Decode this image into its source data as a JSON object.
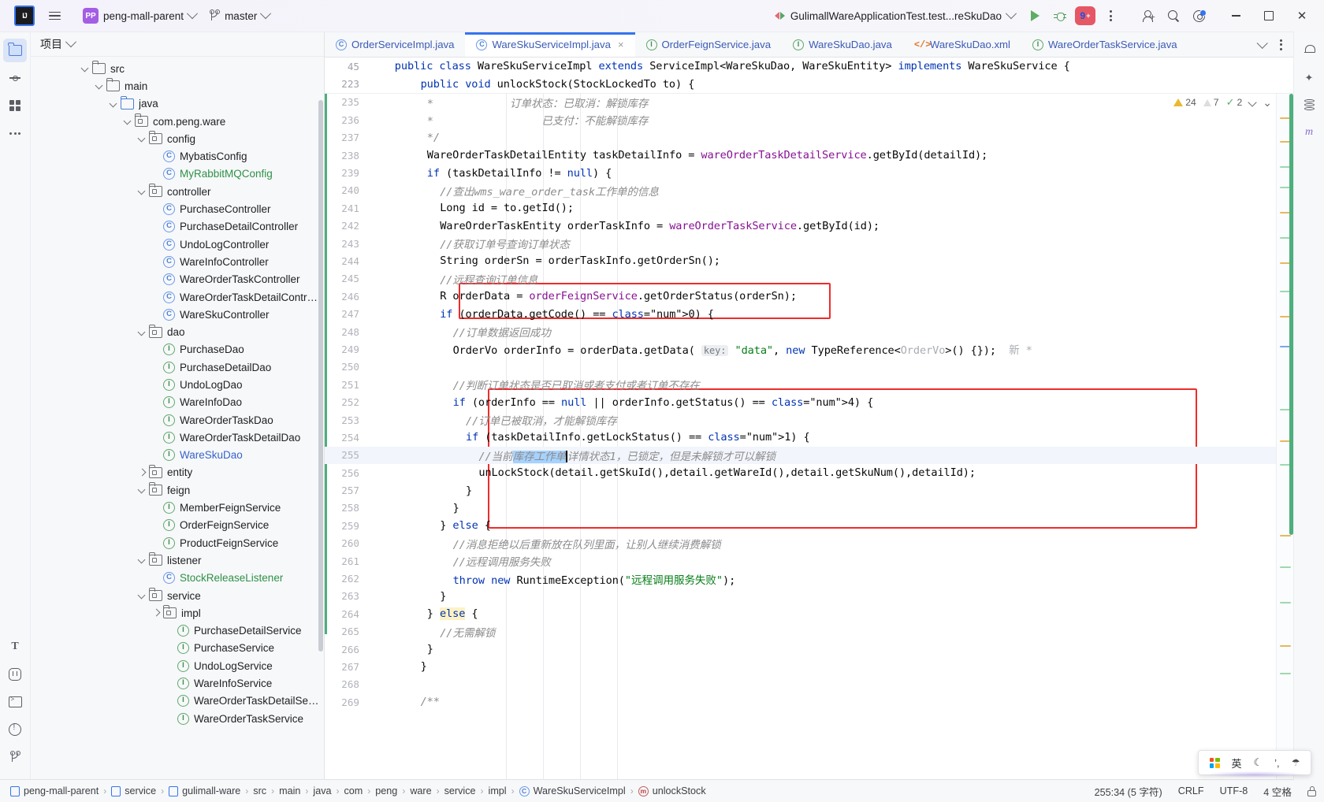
{
  "titlebar": {
    "logo": "IJ",
    "menu_icon": "hamburger-menu-icon",
    "project_badge": "PP",
    "project_name": "peng-mall-parent",
    "branch_name": "master",
    "run_config": "GulimallWareApplicationTest.test...reSkuDao",
    "run_label": "run-button",
    "debug_label": "debug-button",
    "problems_count": "9",
    "problems_plus": "+",
    "more_label": "more-actions",
    "account_label": "account",
    "search_label": "search-everywhere",
    "settings_label": "settings",
    "minimize": "minimize",
    "maximize": "maximize",
    "close": "close"
  },
  "rail": {
    "top_items": [
      {
        "name": "project",
        "icon": "folder-icon"
      },
      {
        "name": "commit",
        "icon": "commit-icon"
      },
      {
        "name": "structure",
        "icon": "structure-icon"
      },
      {
        "name": "more-tool-windows",
        "icon": "more-dots-icon"
      }
    ],
    "bottom_items": [
      {
        "name": "translation",
        "icon": "letter-t-icon"
      },
      {
        "name": "debugger",
        "icon": "bug-icon"
      },
      {
        "name": "terminal",
        "icon": "terminal-icon"
      },
      {
        "name": "problems",
        "icon": "warning-icon"
      },
      {
        "name": "version-control",
        "icon": "branch-icon"
      }
    ],
    "right_items": [
      {
        "name": "notifications",
        "icon": "bell-icon"
      },
      {
        "name": "ai-assistant",
        "icon": "ai-icon"
      },
      {
        "name": "database",
        "icon": "database-icon"
      },
      {
        "name": "maven",
        "icon": "maven-m-icon"
      }
    ]
  },
  "project_panel": {
    "title": "项目",
    "tree": [
      {
        "label": "src",
        "indent": 3,
        "type": "folder",
        "arrow": "down",
        "color": ""
      },
      {
        "label": "main",
        "indent": 4,
        "type": "folder",
        "arrow": "down",
        "color": ""
      },
      {
        "label": "java",
        "indent": 5,
        "type": "folder-blue",
        "arrow": "down",
        "color": ""
      },
      {
        "label": "com.peng.ware",
        "indent": 6,
        "type": "package",
        "arrow": "down",
        "color": ""
      },
      {
        "label": "config",
        "indent": 7,
        "type": "package",
        "arrow": "down",
        "color": ""
      },
      {
        "label": "MybatisConfig",
        "indent": 8,
        "type": "class",
        "arrow": "",
        "color": ""
      },
      {
        "label": "MyRabbitMQConfig",
        "indent": 8,
        "type": "class",
        "arrow": "",
        "color": "green"
      },
      {
        "label": "controller",
        "indent": 7,
        "type": "package",
        "arrow": "down",
        "color": ""
      },
      {
        "label": "PurchaseController",
        "indent": 8,
        "type": "class",
        "arrow": "",
        "color": ""
      },
      {
        "label": "PurchaseDetailController",
        "indent": 8,
        "type": "class",
        "arrow": "",
        "color": ""
      },
      {
        "label": "UndoLogController",
        "indent": 8,
        "type": "class",
        "arrow": "",
        "color": ""
      },
      {
        "label": "WareInfoController",
        "indent": 8,
        "type": "class",
        "arrow": "",
        "color": ""
      },
      {
        "label": "WareOrderTaskController",
        "indent": 8,
        "type": "class",
        "arrow": "",
        "color": ""
      },
      {
        "label": "WareOrderTaskDetailController",
        "indent": 8,
        "type": "class",
        "arrow": "",
        "color": ""
      },
      {
        "label": "WareSkuController",
        "indent": 8,
        "type": "class",
        "arrow": "",
        "color": ""
      },
      {
        "label": "dao",
        "indent": 7,
        "type": "package",
        "arrow": "down",
        "color": ""
      },
      {
        "label": "PurchaseDao",
        "indent": 8,
        "type": "interface",
        "arrow": "",
        "color": ""
      },
      {
        "label": "PurchaseDetailDao",
        "indent": 8,
        "type": "interface",
        "arrow": "",
        "color": ""
      },
      {
        "label": "UndoLogDao",
        "indent": 8,
        "type": "interface",
        "arrow": "",
        "color": ""
      },
      {
        "label": "WareInfoDao",
        "indent": 8,
        "type": "interface",
        "arrow": "",
        "color": ""
      },
      {
        "label": "WareOrderTaskDao",
        "indent": 8,
        "type": "interface",
        "arrow": "",
        "color": ""
      },
      {
        "label": "WareOrderTaskDetailDao",
        "indent": 8,
        "type": "interface",
        "arrow": "",
        "color": ""
      },
      {
        "label": "WareSkuDao",
        "indent": 8,
        "type": "interface",
        "arrow": "",
        "color": "blueTxt"
      },
      {
        "label": "entity",
        "indent": 7,
        "type": "package",
        "arrow": "right",
        "color": ""
      },
      {
        "label": "feign",
        "indent": 7,
        "type": "package",
        "arrow": "down",
        "color": ""
      },
      {
        "label": "MemberFeignService",
        "indent": 8,
        "type": "interface",
        "arrow": "",
        "color": ""
      },
      {
        "label": "OrderFeignService",
        "indent": 8,
        "type": "interface",
        "arrow": "",
        "color": ""
      },
      {
        "label": "ProductFeignService",
        "indent": 8,
        "type": "interface",
        "arrow": "",
        "color": ""
      },
      {
        "label": "listener",
        "indent": 7,
        "type": "package",
        "arrow": "down",
        "color": ""
      },
      {
        "label": "StockReleaseListener",
        "indent": 8,
        "type": "class",
        "arrow": "",
        "color": "green"
      },
      {
        "label": "service",
        "indent": 7,
        "type": "package",
        "arrow": "down",
        "color": ""
      },
      {
        "label": "impl",
        "indent": 8,
        "type": "package",
        "arrow": "right",
        "color": ""
      },
      {
        "label": "PurchaseDetailService",
        "indent": 9,
        "type": "interface",
        "arrow": "",
        "color": ""
      },
      {
        "label": "PurchaseService",
        "indent": 9,
        "type": "interface",
        "arrow": "",
        "color": ""
      },
      {
        "label": "UndoLogService",
        "indent": 9,
        "type": "interface",
        "arrow": "",
        "color": ""
      },
      {
        "label": "WareInfoService",
        "indent": 9,
        "type": "interface",
        "arrow": "",
        "color": ""
      },
      {
        "label": "WareOrderTaskDetailService",
        "indent": 9,
        "type": "interface",
        "arrow": "",
        "color": ""
      },
      {
        "label": "WareOrderTaskService",
        "indent": 9,
        "type": "interface",
        "arrow": "",
        "color": ""
      }
    ]
  },
  "editor": {
    "tabs": [
      {
        "label": "OrderServiceImpl.java",
        "icon": "class-icon",
        "active": false,
        "closable": false
      },
      {
        "label": "WareSkuServiceImpl.java",
        "icon": "class-icon",
        "active": true,
        "closable": true
      },
      {
        "label": "OrderFeignService.java",
        "icon": "interface-icon",
        "active": false,
        "closable": false
      },
      {
        "label": "WareSkuDao.java",
        "icon": "interface-icon",
        "active": false,
        "closable": false
      },
      {
        "label": "WareSkuDao.xml",
        "icon": "xml-icon",
        "active": false,
        "closable": false
      },
      {
        "label": "WareOrderTaskService.java",
        "icon": "interface-icon",
        "active": false,
        "closable": false
      }
    ],
    "close_tab_glyph": "×",
    "sticky_lines": [
      {
        "num": "45",
        "indent": 4
      },
      {
        "num": "223",
        "indent": 8
      }
    ],
    "inspection": {
      "warnings": "24",
      "weak_warnings": "7",
      "checks": "2",
      "ok_glyph": "✓"
    },
    "lines": [
      {
        "num": "235",
        "indent": 9,
        "text": "*            订单状态：已取消：解锁库存",
        "kind": "comment"
      },
      {
        "num": "236",
        "indent": 9,
        "text": "*                 已支付：不能解锁库存",
        "kind": "comment"
      },
      {
        "num": "237",
        "indent": 9,
        "text": "*/",
        "kind": "comment"
      },
      {
        "num": "238",
        "indent": 9,
        "text": "WareOrderTaskDetailEntity taskDetailInfo = wareOrderTaskDetailService.getById(detailId);",
        "kind": "code"
      },
      {
        "num": "239",
        "indent": 9,
        "text": "if (taskDetailInfo != null) {",
        "kind": "code"
      },
      {
        "num": "240",
        "indent": 11,
        "text": "//查出wms_ware_order_task工作单的信息",
        "kind": "comment"
      },
      {
        "num": "241",
        "indent": 11,
        "text": "Long id = to.getId();",
        "kind": "code"
      },
      {
        "num": "242",
        "indent": 11,
        "text": "WareOrderTaskEntity orderTaskInfo = wareOrderTaskService.getById(id);",
        "kind": "code"
      },
      {
        "num": "243",
        "indent": 11,
        "text": "//获取订单号查询订单状态",
        "kind": "comment"
      },
      {
        "num": "244",
        "indent": 11,
        "text": "String orderSn = orderTaskInfo.getOrderSn();",
        "kind": "code"
      },
      {
        "num": "245",
        "indent": 11,
        "text": "//远程查询订单信息",
        "kind": "comment"
      },
      {
        "num": "246",
        "indent": 11,
        "text": "R orderData = orderFeignService.getOrderStatus(orderSn);",
        "kind": "code"
      },
      {
        "num": "247",
        "indent": 11,
        "text": "if (orderData.getCode() == 0) {",
        "kind": "code"
      },
      {
        "num": "248",
        "indent": 13,
        "text": "//订单数据返回成功",
        "kind": "comment"
      },
      {
        "num": "249",
        "indent": 13,
        "text": "OrderVo orderInfo = orderData.getData( key: \"data\", new TypeReference<OrderVo>() {});  新 *",
        "kind": "code"
      },
      {
        "num": "250",
        "indent": 0,
        "text": "",
        "kind": "blank"
      },
      {
        "num": "251",
        "indent": 13,
        "text": "//判断订单状态是否已取消或者支付或者订单不存在",
        "kind": "comment"
      },
      {
        "num": "252",
        "indent": 13,
        "text": "if (orderInfo == null || orderInfo.getStatus() == 4) {",
        "kind": "code"
      },
      {
        "num": "253",
        "indent": 15,
        "text": "//订单已被取消，才能解锁库存",
        "kind": "comment"
      },
      {
        "num": "254",
        "indent": 15,
        "text": "if (taskDetailInfo.getLockStatus() == 1) {",
        "kind": "code"
      },
      {
        "num": "255",
        "indent": 17,
        "text": "//当前库存工作单详情状态1，已锁定，但是未解锁才可以解锁",
        "kind": "comment-selected"
      },
      {
        "num": "256",
        "indent": 17,
        "text": "unLockStock(detail.getSkuId(),detail.getWareId(),detail.getSkuNum(),detailId);",
        "kind": "code"
      },
      {
        "num": "257",
        "indent": 15,
        "text": "}",
        "kind": "code"
      },
      {
        "num": "258",
        "indent": 13,
        "text": "}",
        "kind": "code"
      },
      {
        "num": "259",
        "indent": 11,
        "text": "} else {",
        "kind": "code"
      },
      {
        "num": "260",
        "indent": 13,
        "text": "//消息拒绝以后重新放在队列里面，让别人继续消费解锁",
        "kind": "comment"
      },
      {
        "num": "261",
        "indent": 13,
        "text": "//远程调用服务失败",
        "kind": "comment"
      },
      {
        "num": "262",
        "indent": 13,
        "text": "throw new RuntimeException(\"远程调用服务失败\");",
        "kind": "code"
      },
      {
        "num": "263",
        "indent": 11,
        "text": "}",
        "kind": "code"
      },
      {
        "num": "264",
        "indent": 9,
        "text": "} else {",
        "kind": "code"
      },
      {
        "num": "265",
        "indent": 11,
        "text": "//无需解锁",
        "kind": "comment"
      },
      {
        "num": "266",
        "indent": 9,
        "text": "}",
        "kind": "code"
      },
      {
        "num": "267",
        "indent": 8,
        "text": "}",
        "kind": "code"
      },
      {
        "num": "268",
        "indent": 0,
        "text": "",
        "kind": "blank"
      },
      {
        "num": "269",
        "indent": 8,
        "text": "/**",
        "kind": "comment"
      }
    ]
  },
  "statusbar": {
    "breadcrumbs": [
      {
        "label": "peng-mall-parent",
        "icon": "module-icon"
      },
      {
        "label": "service",
        "icon": "module-icon"
      },
      {
        "label": "gulimall-ware",
        "icon": "module-icon"
      },
      {
        "label": "src",
        "icon": ""
      },
      {
        "label": "main",
        "icon": ""
      },
      {
        "label": "java",
        "icon": ""
      },
      {
        "label": "com",
        "icon": ""
      },
      {
        "label": "peng",
        "icon": ""
      },
      {
        "label": "ware",
        "icon": ""
      },
      {
        "label": "service",
        "icon": ""
      },
      {
        "label": "impl",
        "icon": ""
      },
      {
        "label": "WareSkuServiceImpl",
        "icon": "class-icon"
      },
      {
        "label": "unlockStock",
        "icon": "method-icon"
      }
    ],
    "separator": "›",
    "caret_position": "255:34 (5 字符)",
    "line_separator": "CRLF",
    "encoding": "UTF-8",
    "indent": "4 空格",
    "lock": "read-only-toggle"
  },
  "ime_bar": {
    "windows_icon": "windows-logo-icon",
    "lang": "英",
    "moon": "☾",
    "punctuation": "’,",
    "tools": "☂"
  },
  "colors": {
    "accent": "#3574f0",
    "annotation_red": "#ef2b2b",
    "modified_green": "#4caf7d",
    "selection_blue": "#a6d2ff",
    "warning_yellow": "#e8b931",
    "project_badge": "#a45ee5",
    "problems_badge": "#e55765"
  }
}
